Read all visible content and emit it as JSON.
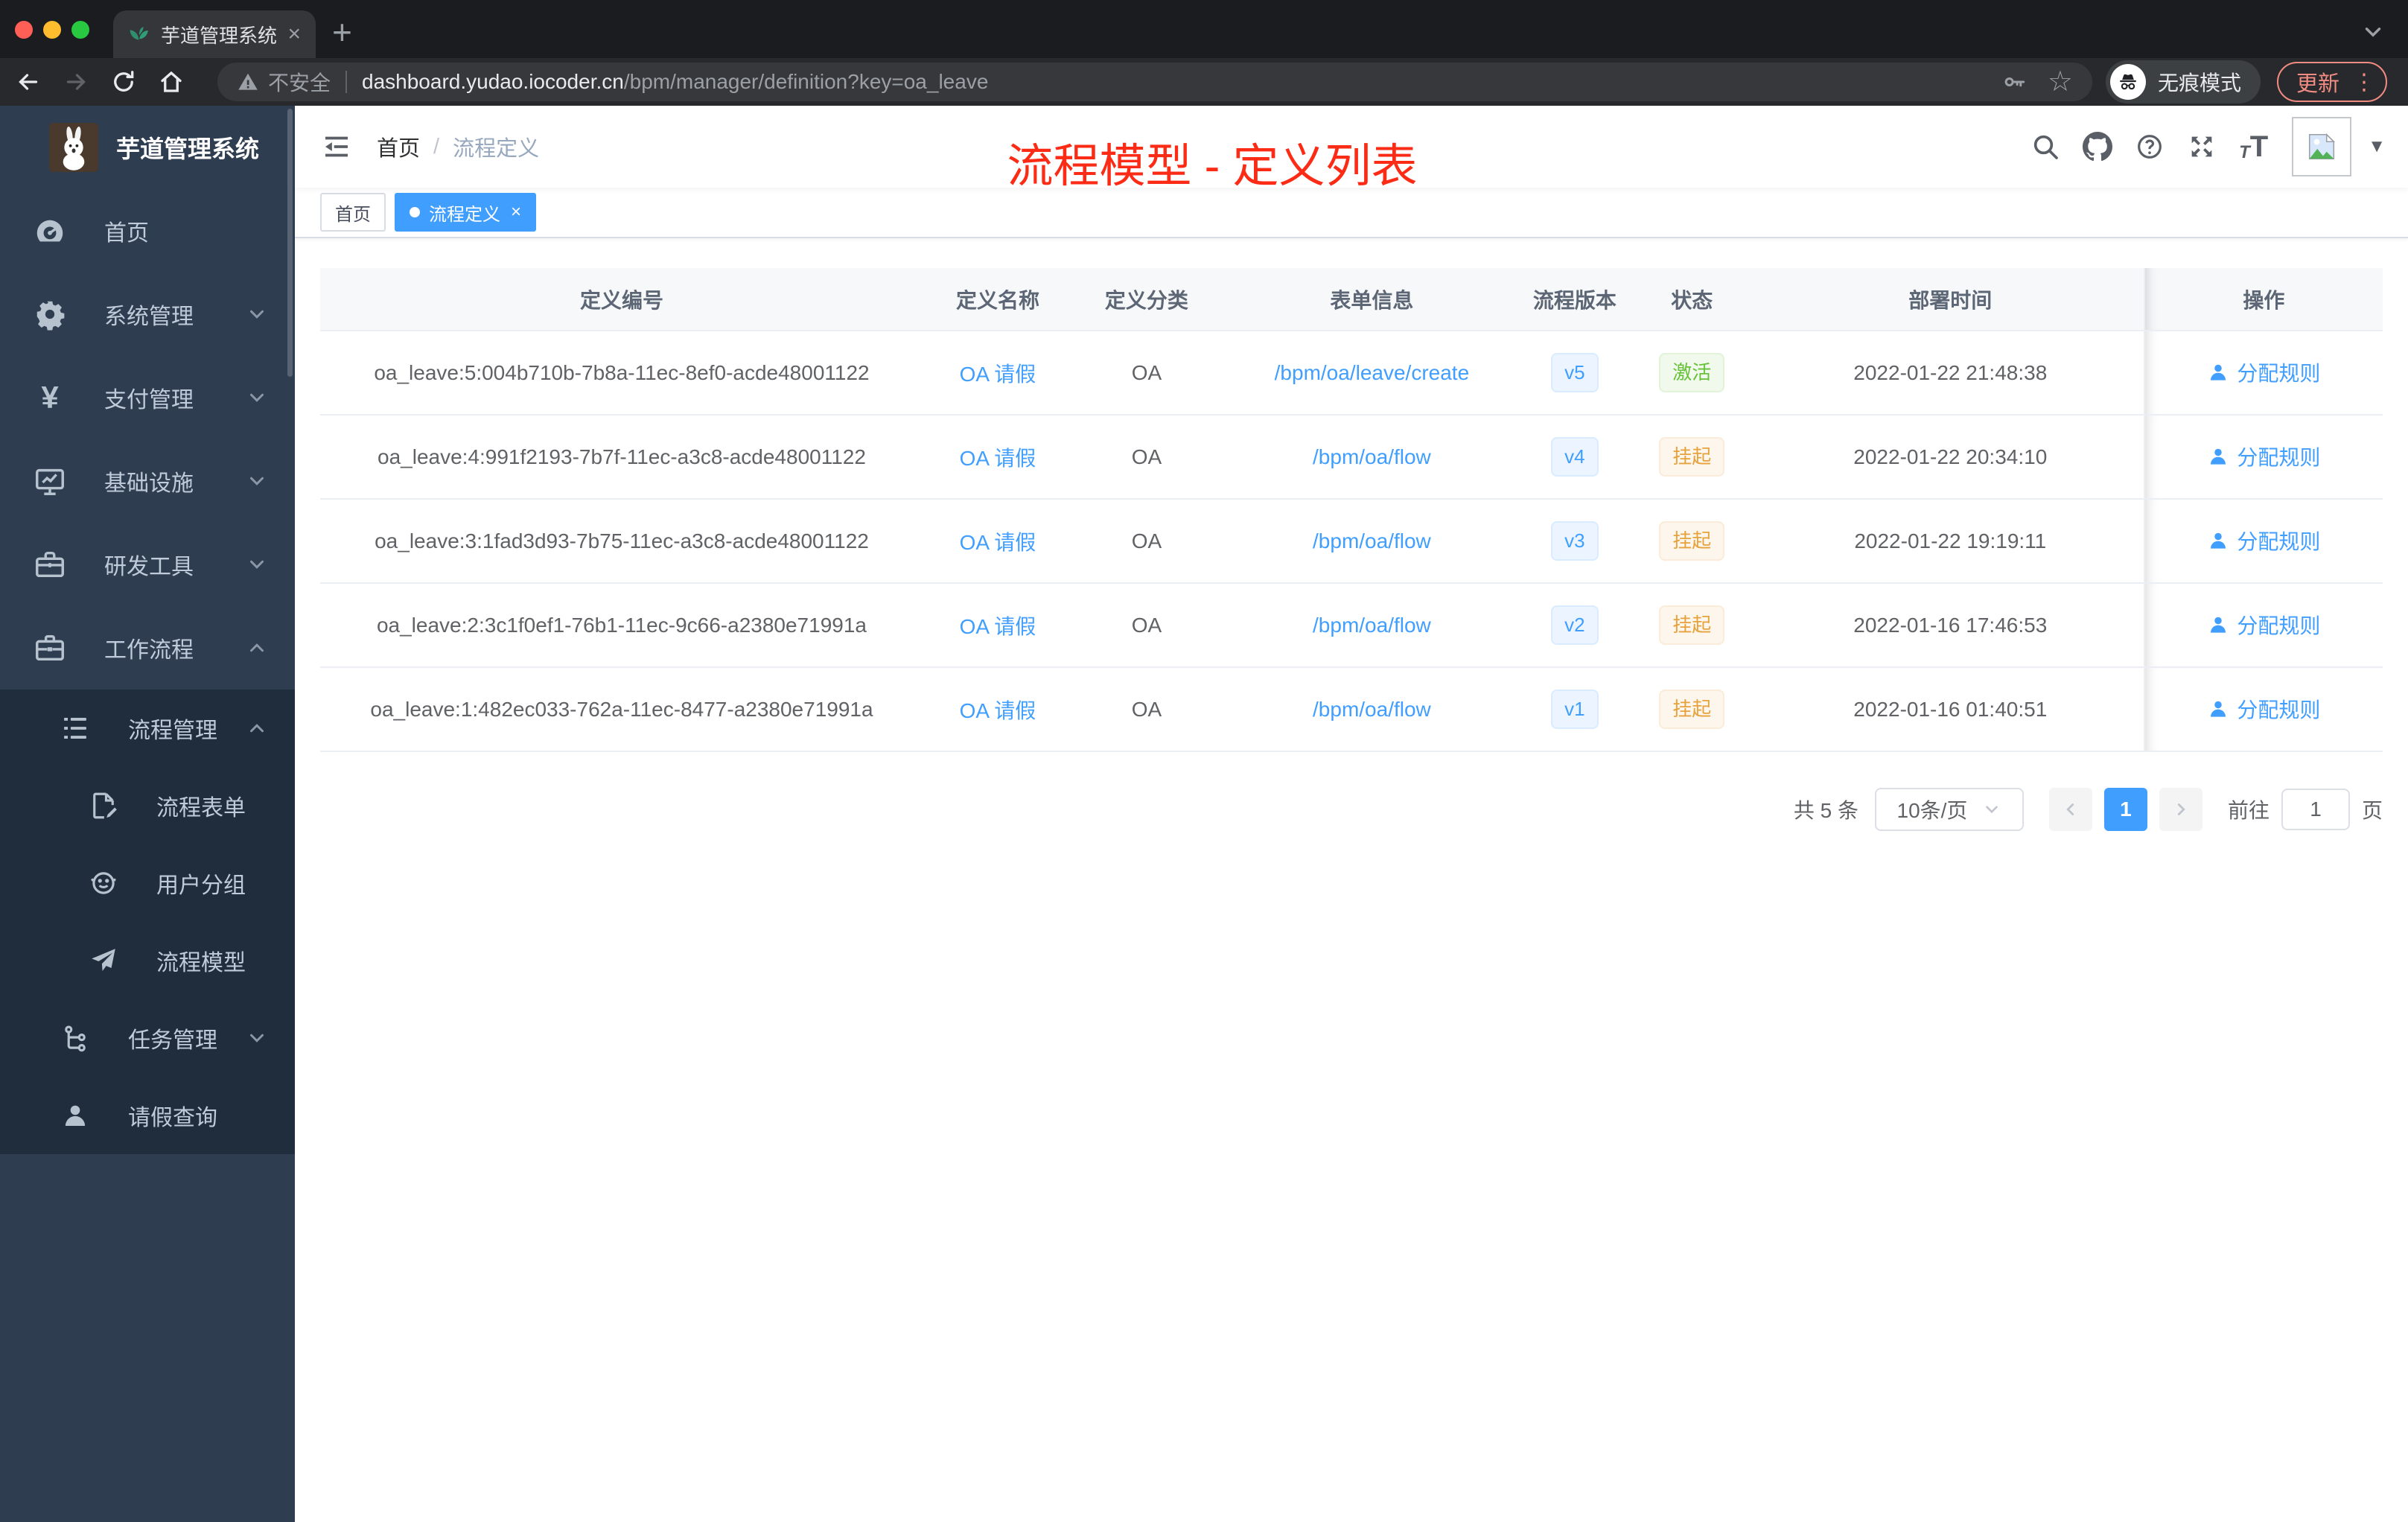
{
  "browser": {
    "tab_title": "芋道管理系统",
    "address": {
      "security_label": "不安全",
      "host": "dashboard.yudao.iocoder.cn",
      "path": "/bpm/manager/definition?key=oa_leave"
    },
    "incognito_label": "无痕模式",
    "update_label": "更新"
  },
  "glyphs": {
    "close": "×",
    "plus": "+",
    "star": "☆",
    "dots": "⋮",
    "yen": "¥",
    "caret_down": "▼"
  },
  "sidebar": {
    "app_title": "芋道管理系统",
    "items": [
      {
        "label": "首页"
      },
      {
        "label": "系统管理"
      },
      {
        "label": "支付管理"
      },
      {
        "label": "基础设施"
      },
      {
        "label": "研发工具"
      },
      {
        "label": "工作流程"
      },
      {
        "label": "流程管理"
      },
      {
        "label": "流程表单"
      },
      {
        "label": "用户分组"
      },
      {
        "label": "流程模型"
      },
      {
        "label": "任务管理"
      },
      {
        "label": "请假查询"
      }
    ]
  },
  "header": {
    "breadcrumb": {
      "home": "首页",
      "separator": "/",
      "current": "流程定义"
    },
    "annotation": "流程模型 - 定义列表"
  },
  "tags": {
    "home": "首页",
    "active": "流程定义"
  },
  "table": {
    "columns": [
      "定义编号",
      "定义名称",
      "定义分类",
      "表单信息",
      "流程版本",
      "状态",
      "部署时间",
      "操作"
    ],
    "rows": [
      {
        "id": "oa_leave:5:004b710b-7b8a-11ec-8ef0-acde48001122",
        "name": "OA 请假",
        "category": "OA",
        "form": "/bpm/oa/leave/create",
        "version": "v5",
        "status": "激活",
        "status_type": "success",
        "deploy_time": "2022-01-22 21:48:38",
        "action": "分配规则"
      },
      {
        "id": "oa_leave:4:991f2193-7b7f-11ec-a3c8-acde48001122",
        "name": "OA 请假",
        "category": "OA",
        "form": "/bpm/oa/flow",
        "version": "v4",
        "status": "挂起",
        "status_type": "warning",
        "deploy_time": "2022-01-22 20:34:10",
        "action": "分配规则"
      },
      {
        "id": "oa_leave:3:1fad3d93-7b75-11ec-a3c8-acde48001122",
        "name": "OA 请假",
        "category": "OA",
        "form": "/bpm/oa/flow",
        "version": "v3",
        "status": "挂起",
        "status_type": "warning",
        "deploy_time": "2022-01-22 19:19:11",
        "action": "分配规则"
      },
      {
        "id": "oa_leave:2:3c1f0ef1-76b1-11ec-9c66-a2380e71991a",
        "name": "OA 请假",
        "category": "OA",
        "form": "/bpm/oa/flow",
        "version": "v2",
        "status": "挂起",
        "status_type": "warning",
        "deploy_time": "2022-01-16 17:46:53",
        "action": "分配规则"
      },
      {
        "id": "oa_leave:1:482ec033-762a-11ec-8477-a2380e71991a",
        "name": "OA 请假",
        "category": "OA",
        "form": "/bpm/oa/flow",
        "version": "v1",
        "status": "挂起",
        "status_type": "warning",
        "deploy_time": "2022-01-16 01:40:51",
        "action": "分配规则"
      }
    ]
  },
  "pagination": {
    "total_label": "共 5 条",
    "page_size": "10条/页",
    "current_page": "1",
    "goto_label": "前往",
    "goto_value": "1",
    "page_unit": "页"
  },
  "colors": {
    "accent": "#409eff",
    "success": "#67c23a",
    "warning": "#e6a23c",
    "annotation_red": "#fb2b15",
    "sidebar_bg": "#2f3d50",
    "submenu_bg": "#1f2d3d",
    "update_red": "#f28b82"
  }
}
